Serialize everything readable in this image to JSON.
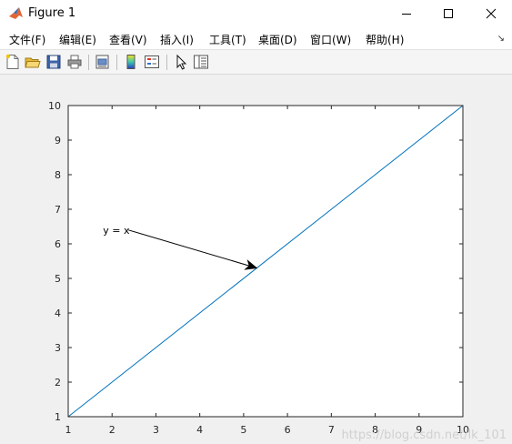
{
  "window": {
    "title": "Figure 1",
    "controls": {
      "minimize": "minimize",
      "maximize": "maximize",
      "close": "close"
    }
  },
  "menu": {
    "items": [
      "文件(F)",
      "编辑(E)",
      "查看(V)",
      "插入(I)",
      "工具(T)",
      "桌面(D)",
      "窗口(W)",
      "帮助(H)"
    ]
  },
  "toolbar": {
    "buttons": [
      "new-file-icon",
      "open-folder-icon",
      "save-icon",
      "print-icon",
      "print-preview-icon",
      "colorbar-icon",
      "legend-icon",
      "pointer-icon",
      "property-editor-icon"
    ]
  },
  "annotation": {
    "text": "y = x"
  },
  "watermark": "https://blog.csdn.net/lk_101",
  "chart_data": {
    "type": "line",
    "title": "",
    "xlabel": "",
    "ylabel": "",
    "xlim": [
      1,
      10
    ],
    "ylim": [
      1,
      10
    ],
    "xticks": [
      1,
      2,
      3,
      4,
      5,
      6,
      7,
      8,
      9,
      10
    ],
    "yticks": [
      1,
      2,
      3,
      4,
      5,
      6,
      7,
      8,
      9,
      10
    ],
    "grid": false,
    "series": [
      {
        "color": "#0072bd",
        "x": [
          1,
          10
        ],
        "y": [
          1,
          10
        ]
      }
    ],
    "arrow": {
      "from": [
        2.0,
        6.4
      ],
      "to": [
        5.3,
        5.3
      ],
      "color": "#000000"
    }
  }
}
